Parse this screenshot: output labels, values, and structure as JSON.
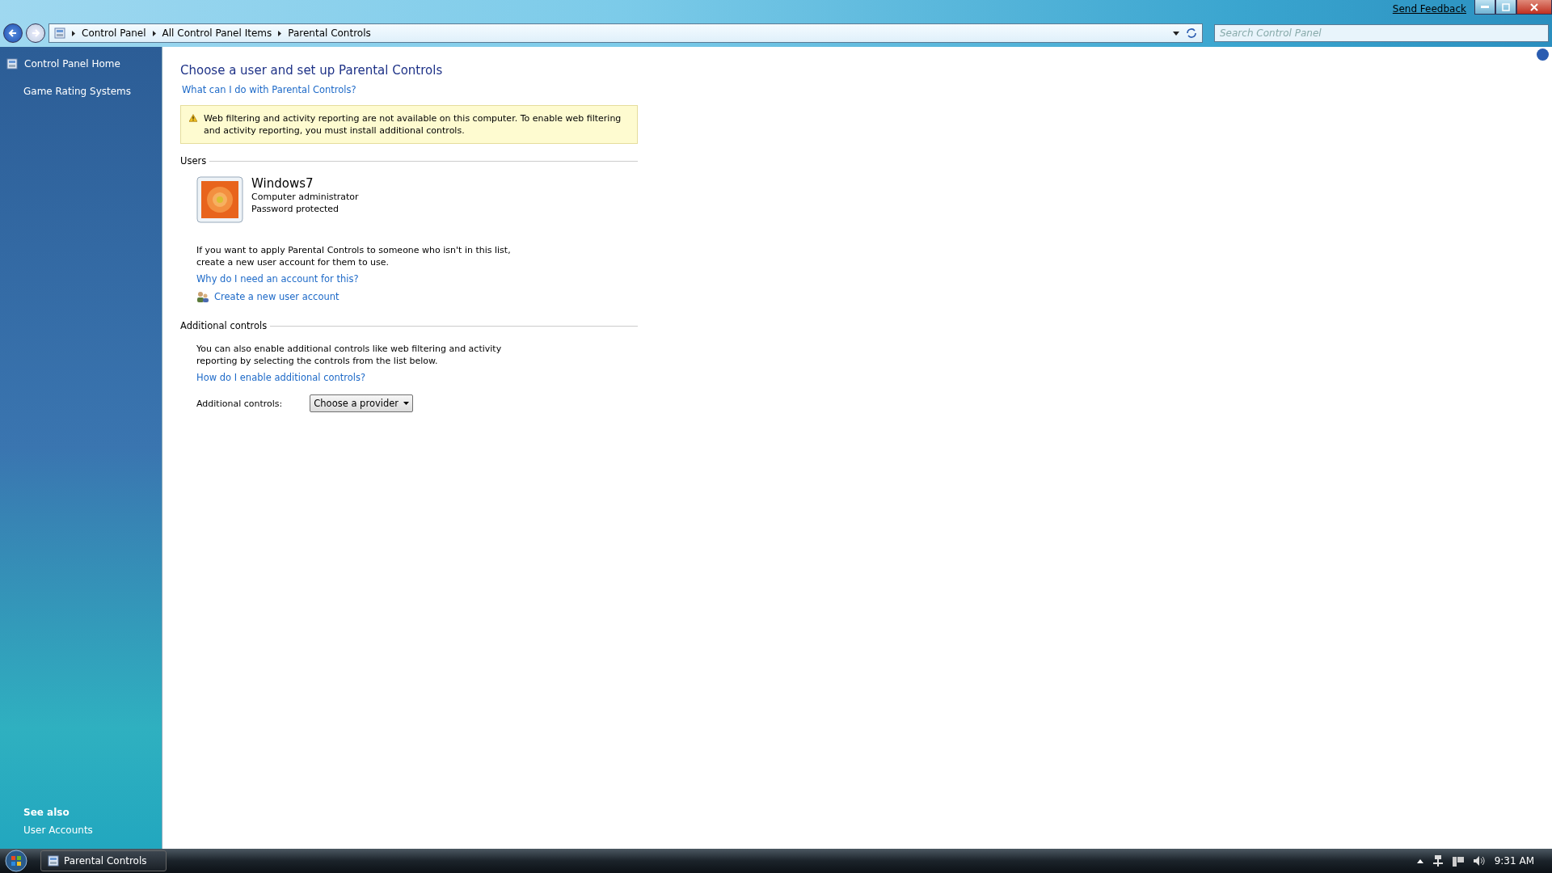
{
  "window": {
    "send_feedback": "Send Feedback",
    "search": {
      "placeholder": "Search Control Panel"
    }
  },
  "breadcrumb": [
    "Control Panel",
    "All Control Panel Items",
    "Parental Controls"
  ],
  "sidebar": {
    "items": [
      {
        "label": "Control Panel Home",
        "kind": "icon"
      },
      {
        "label": "Game Rating Systems",
        "kind": "plain"
      }
    ],
    "see_also": {
      "title": "See also",
      "items": [
        "User Accounts"
      ]
    }
  },
  "content": {
    "title": "Choose a user and set up Parental Controls",
    "help_link": "What can I do with Parental Controls?",
    "warning": "Web filtering and activity reporting are not available on this computer. To enable web filtering and activity reporting, you must install additional controls.",
    "users_section": {
      "label": "Users",
      "users": [
        {
          "name": "Windows7",
          "role": "Computer administrator",
          "password": "Password protected"
        }
      ],
      "note": "If you want to apply Parental Controls to someone who isn't in this list, create a new user account for them to use.",
      "links": [
        {
          "text": "Why do I need an account for this?",
          "kind": "plain"
        },
        {
          "text": "Create a new user account",
          "kind": "icon"
        }
      ]
    },
    "additional_section": {
      "label": "Additional controls",
      "note": "You can also enable additional controls like web filtering and activity reporting by selecting the controls from the list below.",
      "link": "How do I enable additional controls?",
      "field_label": "Additional controls:",
      "dropdown": "Choose a provider"
    }
  },
  "taskbar": {
    "buttons": [
      {
        "label": "Parental Controls"
      }
    ],
    "clock": "9:31 AM"
  }
}
